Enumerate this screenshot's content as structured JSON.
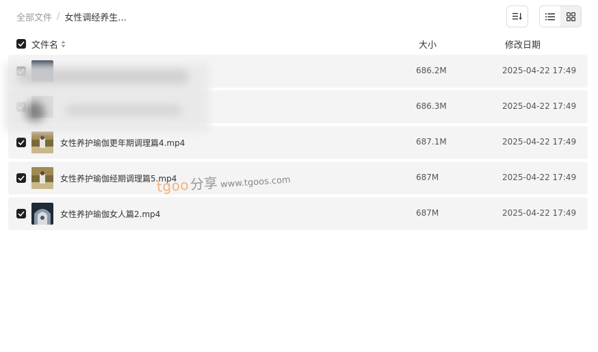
{
  "breadcrumb": {
    "root": "全部文件",
    "separator": "/",
    "current": "女性调经养生..."
  },
  "toolbar": {
    "sort_icon": "sort-icon",
    "list_view_icon": "list-view-icon",
    "grid_view_icon": "grid-view-icon",
    "active_view": "list"
  },
  "header": {
    "name": "文件名",
    "size": "大小",
    "date": "修改日期",
    "sort_icon": "sort-toggle-icon"
  },
  "files": [
    {
      "name": "",
      "size": "686.2M",
      "date": "2025-04-22 17:49",
      "checked": true,
      "thumb": "video-thumb-dark"
    },
    {
      "name": "",
      "size": "686.3M",
      "date": "2025-04-22 17:49",
      "checked": true,
      "thumb": "video-thumb-dark"
    },
    {
      "name": "女性养护瑜伽更年期调理篇4.mp4",
      "size": "687.1M",
      "date": "2025-04-22 17:49",
      "checked": true,
      "thumb": "video-thumb-outdoor"
    },
    {
      "name": "女性养护瑜伽经期调理篇5.mp4",
      "size": "687M",
      "date": "2025-04-22 17:49",
      "checked": true,
      "thumb": "video-thumb-outdoor"
    },
    {
      "name": "女性养护瑜伽女人篇2.mp4",
      "size": "687M",
      "date": "2025-04-22 17:49",
      "checked": true,
      "thumb": "video-thumb-arch"
    }
  ],
  "watermark": {
    "brand": "tgoo",
    "share": "分享",
    "url": "www.tgoos.com"
  },
  "colors": {
    "row_bg": "#f4f4f5",
    "checkbox": "#1f1f1f",
    "watermark_brand": "#f2b37a"
  }
}
